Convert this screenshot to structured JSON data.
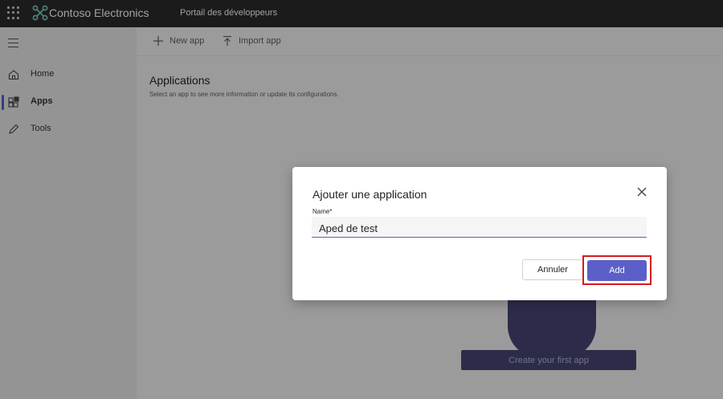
{
  "topbar": {
    "app_name": "Contoso Electronics",
    "portal_title": "Portail des développeurs",
    "background_color": "#2b2b2b"
  },
  "sidebar": {
    "items": [
      {
        "label": "Home",
        "icon": "home-icon"
      },
      {
        "label": "Apps",
        "icon": "apps-icon",
        "active": true
      },
      {
        "label": "Tools",
        "icon": "pencil-icon"
      }
    ]
  },
  "toolbar": {
    "new_app_label": "New app",
    "import_app_label": "Import app"
  },
  "main": {
    "title": "Applications",
    "subtitle": "Select an app to see more information or update its configurations.",
    "create_first_app_label": "Create your first app"
  },
  "dialog": {
    "title": "Ajouter une application",
    "name_label": "Name*",
    "name_value": "Aped de test",
    "cancel_label": "Annuler",
    "add_label": "Add",
    "accent_color": "#5b5fc7",
    "highlight_color": "#d7191f"
  }
}
